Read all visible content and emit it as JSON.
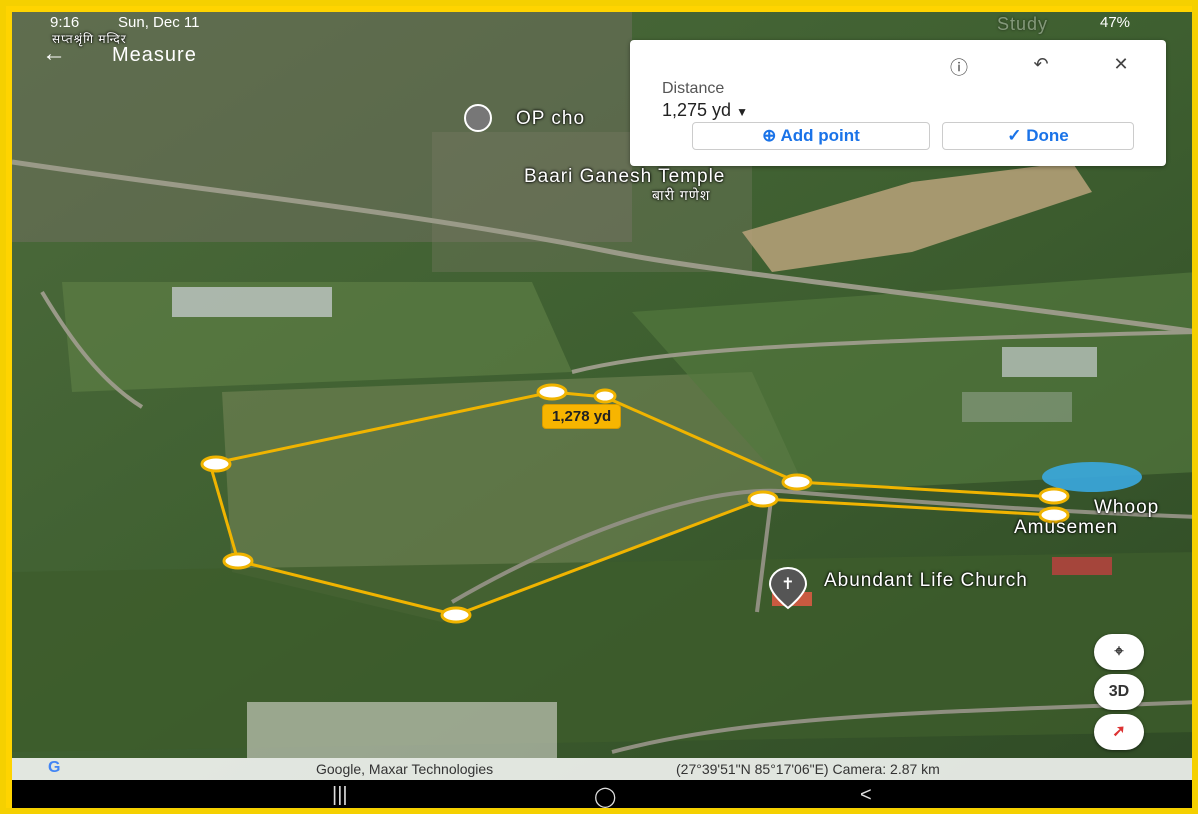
{
  "status_bar": {
    "time": "9:16",
    "date": "Sun, Dec 11",
    "battery": "47%"
  },
  "topbar": {
    "back_icon": "arrow-left-icon",
    "title": "Measure"
  },
  "panel": {
    "help_icon": "help-circle-icon",
    "undo_icon": "undo-icon",
    "close_icon": "close-icon",
    "distance_label": "Distance",
    "distance_value": "1,275 yd",
    "add_point_label": "Add point",
    "done_label": "Done"
  },
  "map_labels": {
    "op_chowk": "OP cho",
    "temple_en": "Baari Ganesh Temple",
    "temple_np": "बारी गणेश",
    "church": "Abundant Life Church",
    "whoop_1": "Whoop",
    "whoop_2": "Amusemen",
    "top_left_np": "सप्तश्रृंगि मन्दिर",
    "study": "Study"
  },
  "measure_tag": "1,278 yd",
  "controls": {
    "location_icon": "my-location-icon",
    "three_d_label": "3D",
    "compass_icon": "compass-icon"
  },
  "attribution": {
    "logo": "G",
    "text": "Google, Maxar Technologies",
    "coords": "(27°39'51\"N 85°17'06\"E) Camera: 2.87 km"
  },
  "colors": {
    "measure_line": "#f0b400",
    "accent": "#1a73e8",
    "frame": "#f5d000"
  }
}
